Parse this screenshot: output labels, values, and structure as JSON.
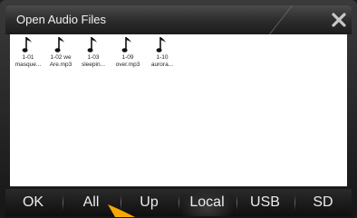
{
  "dialog": {
    "title": "Open Audio Files"
  },
  "files": [
    {
      "line1": "1-01",
      "line2": "masque..."
    },
    {
      "line1": "1-02 we",
      "line2": "Are.mp3"
    },
    {
      "line1": "1-03",
      "line2": "sleepin..."
    },
    {
      "line1": "1-09",
      "line2": "over.mp3"
    },
    {
      "line1": "1-10",
      "line2": "aurora..."
    }
  ],
  "toolbar": {
    "ok_label": "OK",
    "all_label": "All",
    "up_label": "Up",
    "local_label": "Local",
    "usb_label": "USB",
    "sd_label": "SD"
  },
  "colors": {
    "accent_pointer": "#f5a800",
    "file_list_bg": "#ffffff",
    "text": "#ececec"
  },
  "icons": {
    "close": "close-icon",
    "file": "music-note-icon"
  }
}
